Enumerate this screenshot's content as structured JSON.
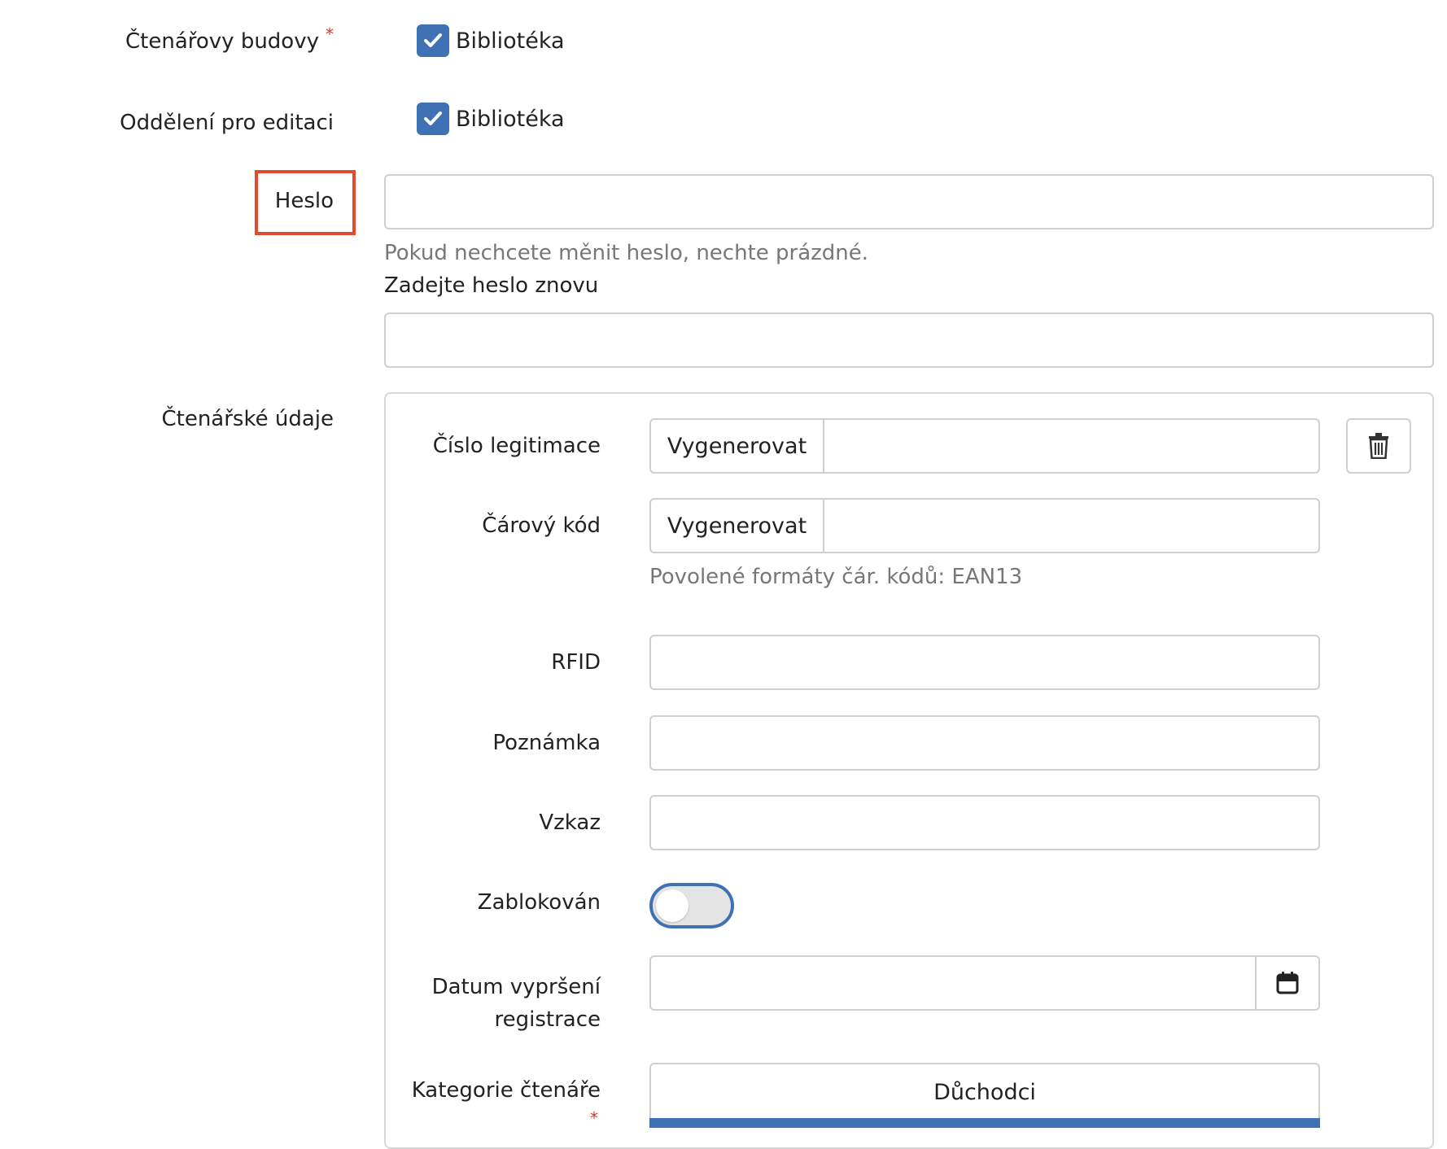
{
  "buildings": {
    "label": "Čtenářovy budovy",
    "required_mark": "*",
    "option": "Bibliotéka",
    "checked": true
  },
  "edit_department": {
    "label": "Oddělení pro editaci",
    "option": "Bibliotéka",
    "checked": true
  },
  "password": {
    "label": "Heslo",
    "value": "",
    "hint": "Pokud nechcete měnit heslo, nechte prázdné.",
    "repeat_label": "Zadejte heslo znovu",
    "repeat_value": ""
  },
  "reader_data": {
    "section_label": "Čtenářské údaje",
    "card_number": {
      "label": "Číslo legitimace",
      "button": "Vygenerovat",
      "value": ""
    },
    "barcode": {
      "label": "Čárový kód",
      "button": "Vygenerovat",
      "value": "",
      "hint": "Povolené formáty čár. kódů: EAN13"
    },
    "rfid": {
      "label": "RFID",
      "value": ""
    },
    "note": {
      "label": "Poznámka",
      "value": ""
    },
    "message": {
      "label": "Vzkaz",
      "value": ""
    },
    "blocked": {
      "label": "Zablokován",
      "on": false
    },
    "expiry": {
      "label_line1": "Datum vypršení",
      "label_line2": "registrace",
      "value": ""
    },
    "category": {
      "label": "Kategorie čtenáře",
      "required_mark": "*",
      "selected": "Důchodci"
    }
  },
  "colors": {
    "accent": "#3f72b5",
    "required": "#d9382b",
    "highlight": "#e2492f"
  },
  "icons": {
    "checkbox": "check-icon",
    "delete": "trash-icon",
    "calendar": "calendar-icon"
  }
}
